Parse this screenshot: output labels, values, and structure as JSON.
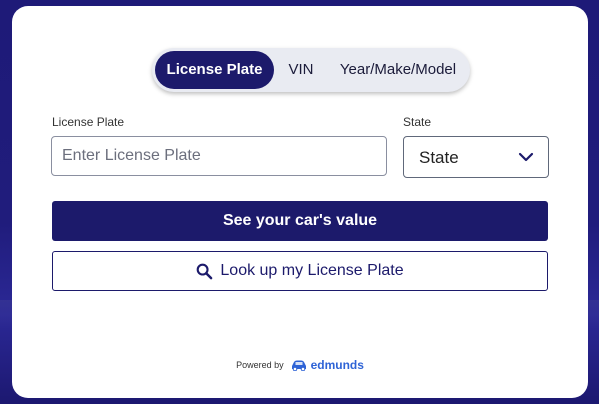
{
  "tabs": [
    {
      "label": "License Plate",
      "active": true
    },
    {
      "label": "VIN",
      "active": false
    },
    {
      "label": "Year/Make/Model",
      "active": false
    }
  ],
  "form": {
    "plate_label": "License Plate",
    "plate_placeholder": "Enter License Plate",
    "plate_value": "",
    "state_label": "State",
    "state_value": "State"
  },
  "buttons": {
    "primary": "See your car's value",
    "secondary": "Look up my License Plate"
  },
  "footer": {
    "powered_by": "Powered by",
    "brand": "edmunds"
  },
  "colors": {
    "accent": "#1c1a6b",
    "background": "#1e1a78",
    "brand": "#2e63d6"
  },
  "icons": [
    "chevron-down-icon",
    "search-icon",
    "car-icon"
  ]
}
